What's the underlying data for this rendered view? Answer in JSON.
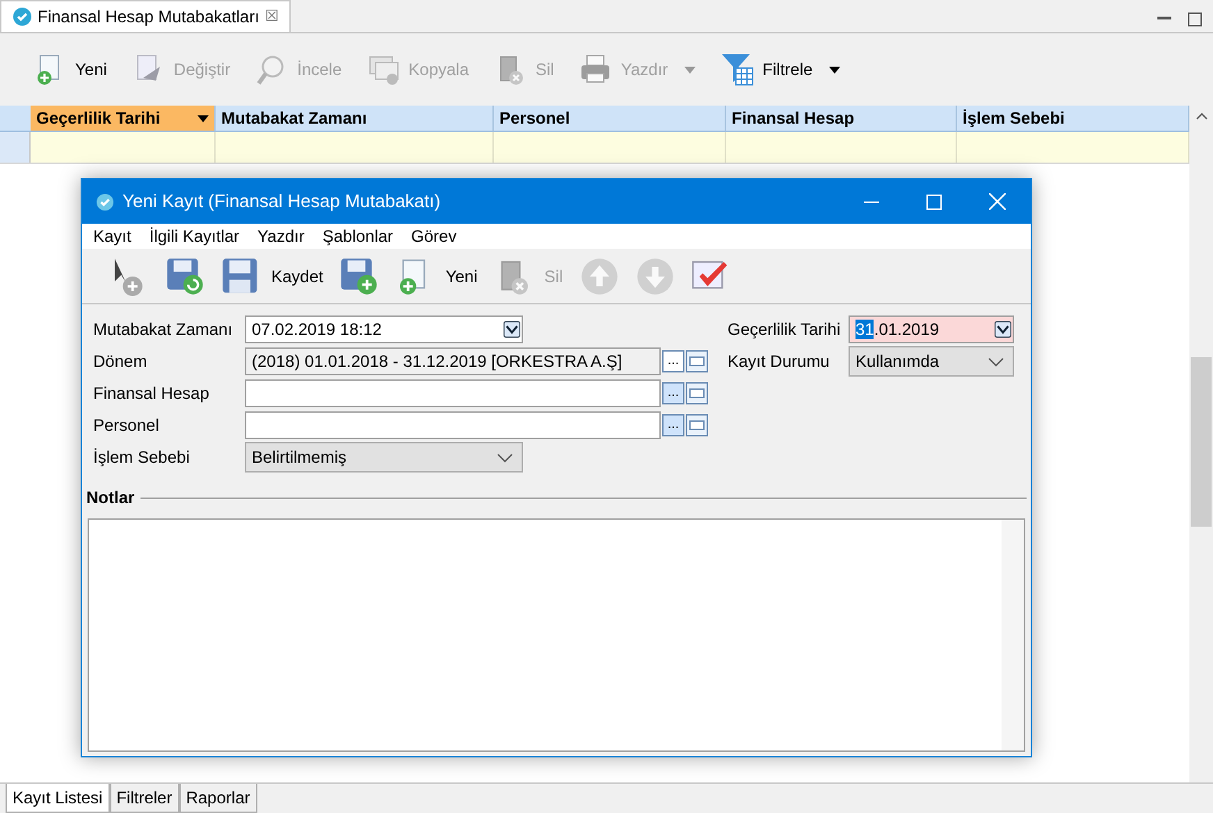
{
  "view_tab": {
    "title": "Finansal Hesap Mutabakatları",
    "close": "☒"
  },
  "toolbar": [
    {
      "kind": "new",
      "label": "Yeni",
      "disabled": false,
      "dropdown": false
    },
    {
      "kind": "edit",
      "label": "Değiştir",
      "disabled": true,
      "dropdown": false
    },
    {
      "kind": "view",
      "label": "İncele",
      "disabled": true,
      "dropdown": false
    },
    {
      "kind": "copy",
      "label": "Kopyala",
      "disabled": true,
      "dropdown": false
    },
    {
      "kind": "delete",
      "label": "Sil",
      "disabled": true,
      "dropdown": false
    },
    {
      "kind": "print",
      "label": "Yazdır",
      "disabled": true,
      "dropdown": true
    },
    {
      "kind": "filter",
      "label": "Filtrele",
      "disabled": false,
      "dropdown": true
    }
  ],
  "table": {
    "columns": [
      {
        "label": "Geçerlilik Tarihi",
        "selected": true
      },
      {
        "label": "Mutabakat Zamanı",
        "selected": false
      },
      {
        "label": "Personel",
        "selected": false
      },
      {
        "label": "Finansal Hesap",
        "selected": false
      },
      {
        "label": "İşlem Sebebi",
        "selected": false
      }
    ]
  },
  "dialog": {
    "title": "Yeni Kayıt (Finansal Hesap Mutabakatı)",
    "menu": [
      "Kayıt",
      "İlgili Kayıtlar",
      "Yazdır",
      "Şablonlar",
      "Görev"
    ],
    "toolbar": [
      {
        "kind": "pointer-add",
        "disabled": false
      },
      {
        "kind": "save-refresh",
        "disabled": false
      },
      {
        "kind": "save",
        "label": "Kaydet",
        "disabled": false
      },
      {
        "kind": "save-add",
        "disabled": false
      },
      {
        "kind": "new",
        "label": "Yeni",
        "disabled": false
      },
      {
        "kind": "delete",
        "label": "Sil",
        "disabled": true
      },
      {
        "kind": "up",
        "disabled": true
      },
      {
        "kind": "down",
        "disabled": true
      },
      {
        "kind": "check",
        "disabled": false
      }
    ],
    "left_fields": [
      {
        "label": "Mutabakat Zamanı",
        "kind": "date",
        "value": "07.02.2019 18:12"
      },
      {
        "label": "Dönem",
        "kind": "lookup",
        "value": "(2018) 01.01.2018 - 31.12.2019 [ORKESTRA A.Ş]",
        "readonly": true,
        "button": "..."
      },
      {
        "label": "Finansal Hesap",
        "kind": "lookup",
        "readonly": false,
        "button": "..."
      },
      {
        "label": "Personel",
        "kind": "lookup",
        "readonly": false,
        "button": "..."
      },
      {
        "label": "İşlem Sebebi",
        "kind": "select",
        "value": "Belirtilmemiş"
      }
    ],
    "right_fields": [
      {
        "label": "Geçerlilik Tarihi",
        "kind": "date",
        "value_selected": "31",
        "value": ".01.2019",
        "required": true
      },
      {
        "label": "Kayıt Durumu",
        "kind": "select",
        "value": "Kullanımda"
      }
    ],
    "notes_label": "Notlar"
  },
  "bottom_tabs": [
    {
      "label": "Kayıt Listesi",
      "selected": true
    },
    {
      "label": "Filtreler",
      "selected": false
    },
    {
      "label": "Raporlar",
      "selected": false
    }
  ]
}
